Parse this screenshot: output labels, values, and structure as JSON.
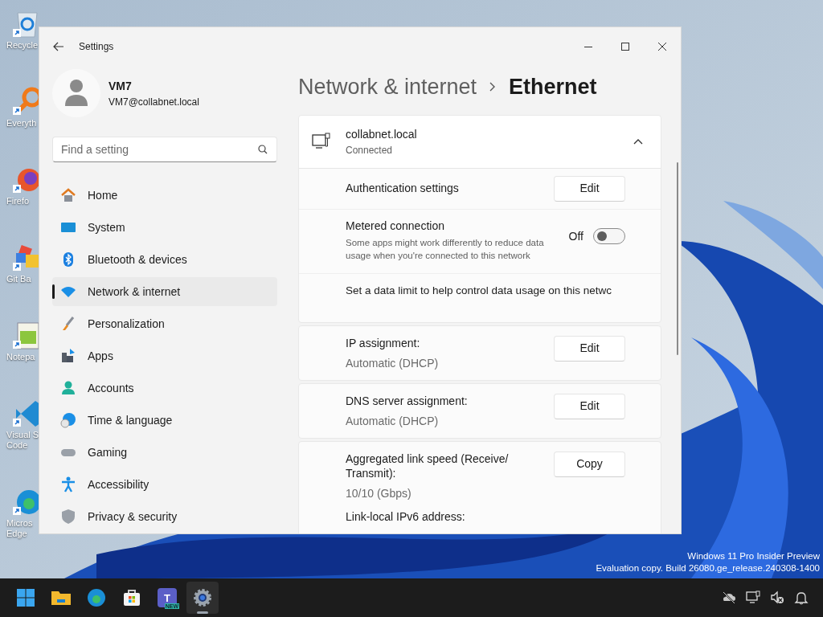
{
  "desktop": {
    "icons": [
      {
        "kind": "recycle",
        "lines": [
          "Recycle"
        ]
      },
      {
        "kind": "search",
        "lines": [
          "Everyth"
        ]
      },
      {
        "kind": "firefox",
        "lines": [
          "Firefo"
        ]
      },
      {
        "kind": "git",
        "lines": [
          "Git Ba"
        ]
      },
      {
        "kind": "notepad",
        "lines": [
          "Notepa"
        ]
      },
      {
        "kind": "code",
        "lines": [
          "Visual S",
          "Code"
        ]
      },
      {
        "kind": "edge",
        "lines": [
          "Micros",
          "Edge"
        ]
      }
    ],
    "watermark": [
      "Windows 11 Pro Insider Preview",
      "Evaluation copy. Build 26080.ge_release.240308-1400"
    ]
  },
  "window": {
    "title": "Settings",
    "user": {
      "name": "VM7",
      "email": "VM7@collabnet.local"
    },
    "search": {
      "placeholder": "Find a setting"
    },
    "nav": [
      {
        "kind": "home",
        "label": "Home",
        "selected": false
      },
      {
        "kind": "system",
        "label": "System",
        "selected": false
      },
      {
        "kind": "bluetooth",
        "label": "Bluetooth & devices",
        "selected": false
      },
      {
        "kind": "network",
        "label": "Network & internet",
        "selected": true
      },
      {
        "kind": "personalization",
        "label": "Personalization",
        "selected": false
      },
      {
        "kind": "apps",
        "label": "Apps",
        "selected": false
      },
      {
        "kind": "accounts",
        "label": "Accounts",
        "selected": false
      },
      {
        "kind": "time",
        "label": "Time & language",
        "selected": false
      },
      {
        "kind": "gaming",
        "label": "Gaming",
        "selected": false
      },
      {
        "kind": "accessibility",
        "label": "Accessibility",
        "selected": false
      },
      {
        "kind": "privacy",
        "label": "Privacy & security",
        "selected": false
      }
    ],
    "breadcrumb": [
      "Network & internet",
      "Ethernet"
    ],
    "connection": {
      "name": "collabnet.local",
      "status": "Connected",
      "expanded": true
    },
    "sections": [
      {
        "rows": [
          {
            "kind": "button",
            "label": "Authentication settings",
            "button": "Edit"
          },
          {
            "kind": "toggle",
            "label": "Metered connection",
            "description": "Some apps might work differently to reduce data usage when you're connected to this network",
            "state_label": "Off",
            "on": false
          },
          {
            "kind": "text",
            "label": "Set a data limit to help control data usage on this netwc"
          }
        ]
      },
      {
        "rows": [
          {
            "kind": "value",
            "label": "IP assignment:",
            "value": "Automatic (DHCP)",
            "button": "Edit"
          }
        ]
      },
      {
        "rows": [
          {
            "kind": "value",
            "label": "DNS server assignment:",
            "value": "Automatic (DHCP)",
            "button": "Edit"
          }
        ]
      },
      {
        "rows": [
          {
            "kind": "value",
            "label": "Aggregated link speed (Receive/ Transmit):",
            "value": "10/10 (Gbps)",
            "button": "Copy"
          },
          {
            "kind": "label",
            "label": "Link-local IPv6 address:"
          }
        ]
      }
    ]
  },
  "taskbar": {
    "apps": [
      {
        "kind": "start",
        "selected": false
      },
      {
        "kind": "folder",
        "selected": false
      },
      {
        "kind": "edge",
        "selected": false
      },
      {
        "kind": "store",
        "selected": false
      },
      {
        "kind": "teams",
        "letter": "T",
        "badge": "NEW",
        "selected": false
      },
      {
        "kind": "settings",
        "selected": true
      }
    ],
    "tray": [
      {
        "kind": "cloud-off"
      },
      {
        "kind": "monitor"
      },
      {
        "kind": "speaker-muted"
      },
      {
        "kind": "bell"
      }
    ]
  }
}
